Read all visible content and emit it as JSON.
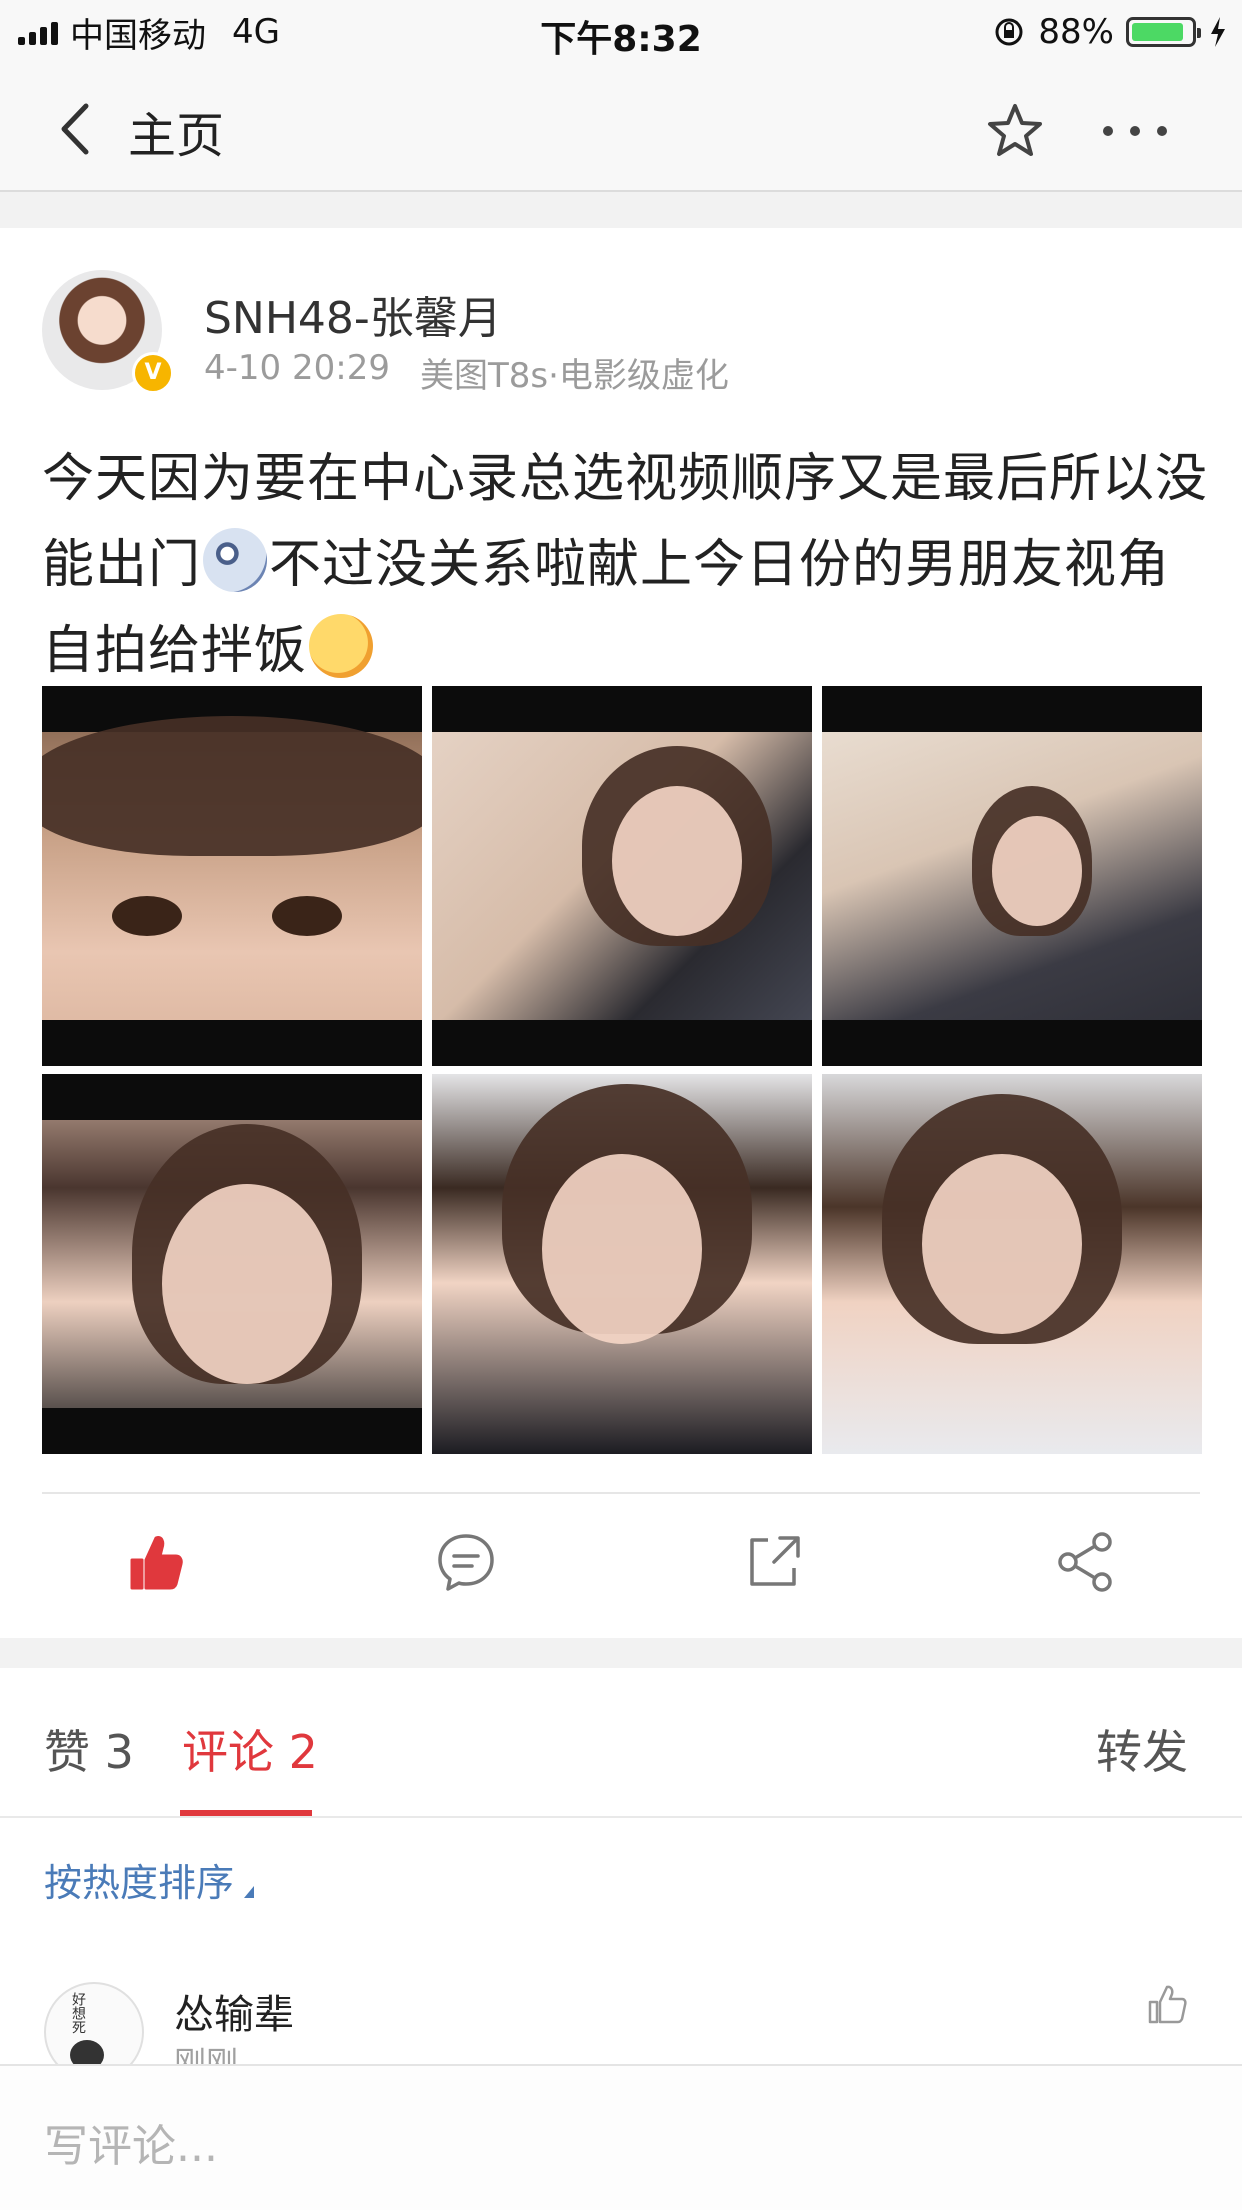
{
  "status_bar": {
    "carrier": "中国移动",
    "network": "4G",
    "time": "下午8:32",
    "battery_percent": "88%",
    "battery_level": 0.88
  },
  "nav": {
    "title": "主页",
    "back_icon": "chevron-left-icon",
    "star_icon": "star-icon",
    "more_icon": "more-icon"
  },
  "post": {
    "author": "SNH48-张馨月",
    "time": "4-10 20:29",
    "source": "美图T8s·电影级虚化",
    "text_part1": "今天因为要在中心录总选视频顺序又是最后所以没能出门",
    "text_part2": "不过没关系啦献上今日份的男朋友视角自拍给拌饭",
    "photo_count": 6
  },
  "actions": {
    "like_icon": "thumbs-up-icon",
    "comment_icon": "comment-icon",
    "repost_icon": "repost-icon",
    "share_icon": "share-icon",
    "like_color": "#e0383d"
  },
  "tabs": {
    "likes": "赞 3",
    "comments": "评论 2",
    "repost": "转发",
    "active_color": "#e0383d"
  },
  "sort": {
    "label": "按热度排序"
  },
  "comments": [
    {
      "name": "怂输辈",
      "time": "刚刚",
      "avatar_text": "好想死"
    }
  ],
  "reply_box": {
    "placeholder": "写评论..."
  }
}
